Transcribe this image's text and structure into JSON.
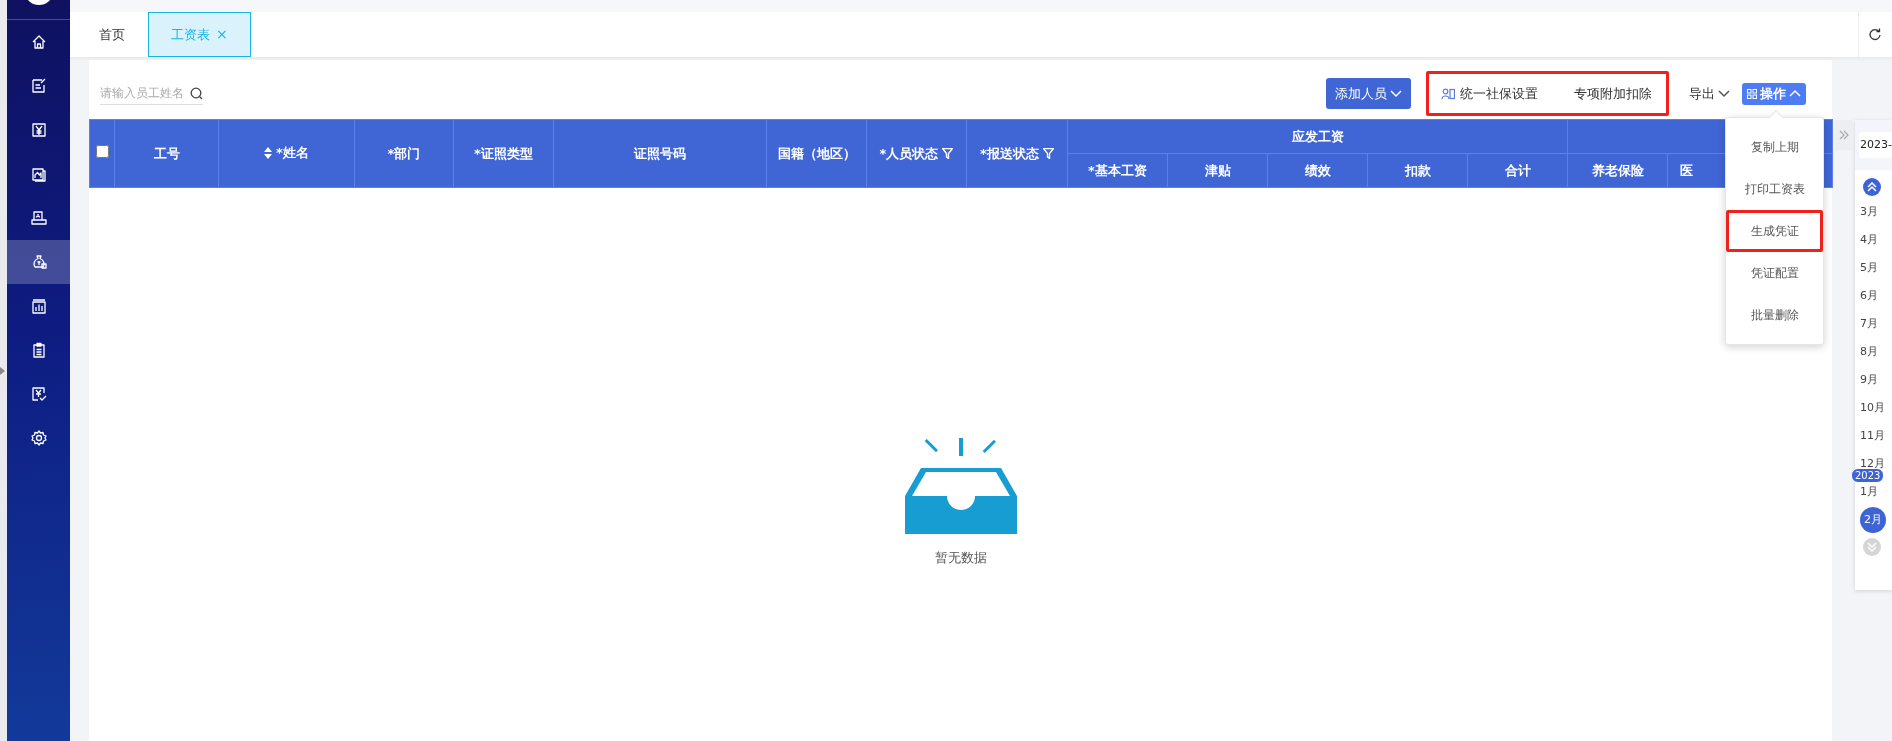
{
  "sidebar": {
    "items": [
      {
        "selected": false
      },
      {
        "selected": false
      },
      {
        "selected": false
      },
      {
        "selected": false
      },
      {
        "selected": false
      },
      {
        "selected": true
      },
      {
        "selected": false
      },
      {
        "selected": false
      },
      {
        "selected": false
      },
      {
        "selected": false
      }
    ]
  },
  "tabs": [
    {
      "label": "首页",
      "selected": false
    },
    {
      "label": "工资表",
      "selected": true,
      "close": "×"
    }
  ],
  "toolbar": {
    "search": {
      "placeholder": "请输入员工姓名"
    },
    "add_button": {
      "label": "添加人员"
    },
    "settings_group": {
      "highlighted": true,
      "items": [
        "统一社保设置",
        "专项附加扣除"
      ]
    },
    "export": {
      "label": "导出"
    },
    "actions": {
      "label": "操作",
      "expanded": true
    }
  },
  "table": {
    "select_all": {
      "checked": false
    },
    "columns": [
      {
        "label": "工号"
      },
      {
        "label": "*姓名",
        "sortable": true
      },
      {
        "label": "*部门"
      },
      {
        "label": "*证照类型"
      },
      {
        "label": "证照号码"
      },
      {
        "label": "国籍（地区）"
      },
      {
        "label": "*人员状态",
        "filterable": true
      },
      {
        "label": "*报送状态",
        "filterable": true
      },
      {
        "label": "应发工资",
        "children": [
          {
            "label": "*基本工资"
          },
          {
            "label": "津贴"
          },
          {
            "label": "绩效"
          },
          {
            "label": "扣款"
          },
          {
            "label": "合计"
          }
        ]
      },
      {
        "children": [
          {
            "label": "养老保险"
          },
          {
            "label": "医"
          }
        ]
      }
    ],
    "empty_text": "暂无数据"
  },
  "actions_menu": {
    "items": [
      {
        "label": "复制上期",
        "highlighted": false
      },
      {
        "label": "打印工资表",
        "highlighted": false
      },
      {
        "label": "生成凭证",
        "highlighted": true
      },
      {
        "label": "凭证配置",
        "highlighted": false
      },
      {
        "label": "批量删除",
        "highlighted": false
      }
    ]
  },
  "calendar": {
    "year_input": "2023-",
    "months": [
      {
        "label": "3月",
        "selected": false
      },
      {
        "label": "4月",
        "selected": false
      },
      {
        "label": "5月",
        "selected": false
      },
      {
        "label": "6月",
        "selected": false
      },
      {
        "label": "7月",
        "selected": false
      },
      {
        "label": "8月",
        "selected": false
      },
      {
        "label": "9月",
        "selected": false
      },
      {
        "label": "10月",
        "selected": false
      },
      {
        "label": "11月",
        "selected": false
      },
      {
        "label": "12月",
        "selected": false
      },
      {
        "label": "1月",
        "selected": false,
        "year_badge": "2023"
      },
      {
        "label": "2月",
        "selected": true
      }
    ]
  }
}
